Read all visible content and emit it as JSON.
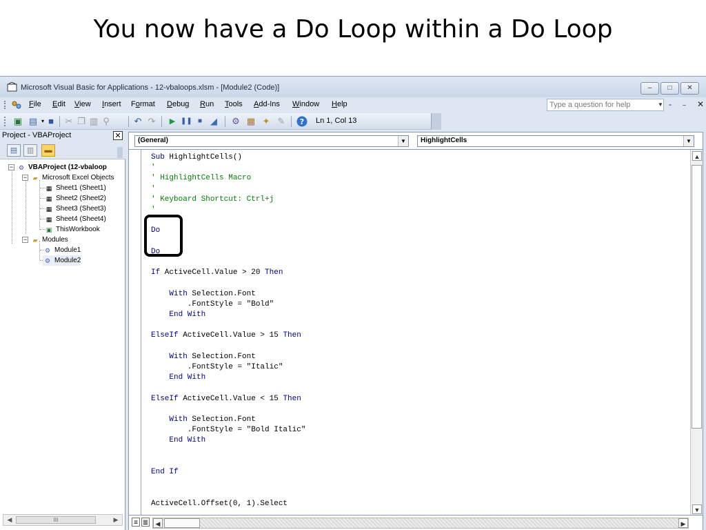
{
  "slide": {
    "title": "You now have a Do Loop within a Do Loop"
  },
  "window": {
    "title": "Microsoft Visual Basic for Applications - 12-vbaloops.xlsm - [Module2 (Code)]",
    "buttons": {
      "minimize": "–",
      "maximize": "□",
      "close": "✕"
    }
  },
  "menubar": {
    "items": [
      {
        "label": "File",
        "key": "F",
        "rest": "ile"
      },
      {
        "label": "Edit",
        "key": "E",
        "rest": "dit"
      },
      {
        "label": "View",
        "key": "V",
        "rest": "iew"
      },
      {
        "label": "Insert",
        "key": "I",
        "rest": "nsert"
      },
      {
        "label": "Format",
        "key": "o",
        "pre": "F",
        "rest": "rmat"
      },
      {
        "label": "Debug",
        "key": "D",
        "rest": "ebug"
      },
      {
        "label": "Run",
        "key": "R",
        "rest": "un"
      },
      {
        "label": "Tools",
        "key": "T",
        "rest": "ools"
      },
      {
        "label": "Add-Ins",
        "key": "A",
        "rest": "dd-Ins"
      },
      {
        "label": "Window",
        "key": "W",
        "rest": "indow"
      },
      {
        "label": "Help",
        "key": "H",
        "rest": "elp"
      }
    ],
    "help_placeholder": "Type a question for help",
    "mdi_buttons": "- ₋ ✕"
  },
  "toolbar": {
    "position": "Ln 1, Col 13",
    "icons": [
      "view-excel-icon",
      "insert-module-icon",
      "save-icon",
      "cut-icon",
      "copy-icon",
      "paste-icon",
      "find-icon",
      "undo-icon",
      "redo-icon",
      "run-icon",
      "break-icon",
      "reset-icon",
      "design-mode-icon",
      "project-explorer-icon",
      "properties-icon",
      "object-browser-icon",
      "toolbox-icon",
      "help-icon"
    ]
  },
  "project": {
    "header": "Project - VBAProject",
    "close": "✕",
    "tree": {
      "root": "VBAProject (12-vbaloop",
      "excel_objects": "Microsoft Excel Objects",
      "sheets": [
        "Sheet1 (Sheet1)",
        "Sheet2 (Sheet2)",
        "Sheet3 (Sheet3)",
        "Sheet4 (Sheet4)",
        "ThisWorkbook"
      ],
      "modules_folder": "Modules",
      "modules": [
        "Module1",
        "Module2"
      ]
    },
    "scroll_thumb": "III"
  },
  "editor": {
    "object_combo": "(General)",
    "procedure_combo": "HighlightCells",
    "code": [
      {
        "text": "Sub HighlightCells()",
        "style": "kw-lead"
      },
      {
        "text": "'",
        "style": "cm"
      },
      {
        "text": "' HighlightCells Macro",
        "style": "cm"
      },
      {
        "text": "'",
        "style": "cm"
      },
      {
        "text": "' Keyboard Shortcut: Ctrl+j",
        "style": "cm"
      },
      {
        "text": "'",
        "style": "cm"
      },
      {
        "text": "",
        "style": "tx"
      },
      {
        "text": "Do",
        "style": "kw"
      },
      {
        "text": "",
        "style": "tx"
      },
      {
        "text": "Do",
        "style": "kw"
      },
      {
        "text": "",
        "style": "tx"
      },
      {
        "text": "If ActiveCell.Value > 20 Then",
        "style": "if"
      },
      {
        "text": "",
        "style": "tx"
      },
      {
        "text": "    With Selection.Font",
        "style": "with"
      },
      {
        "text": "        .FontStyle = \"Bold\"",
        "style": "tx"
      },
      {
        "text": "    End With",
        "style": "kw"
      },
      {
        "text": "",
        "style": "tx"
      },
      {
        "text": "ElseIf ActiveCell.Value > 15 Then",
        "style": "elseif"
      },
      {
        "text": "",
        "style": "tx"
      },
      {
        "text": "    With Selection.Font",
        "style": "with"
      },
      {
        "text": "        .FontStyle = \"Italic\"",
        "style": "tx"
      },
      {
        "text": "    End With",
        "style": "kw"
      },
      {
        "text": "",
        "style": "tx"
      },
      {
        "text": "ElseIf ActiveCell.Value < 15 Then",
        "style": "elseif"
      },
      {
        "text": "",
        "style": "tx"
      },
      {
        "text": "    With Selection.Font",
        "style": "with"
      },
      {
        "text": "        .FontStyle = \"Bold Italic\"",
        "style": "tx"
      },
      {
        "text": "    End With",
        "style": "kw"
      },
      {
        "text": "",
        "style": "tx"
      },
      {
        "text": "",
        "style": "tx"
      },
      {
        "text": "End If",
        "style": "kw"
      },
      {
        "text": "",
        "style": "tx"
      },
      {
        "text": "",
        "style": "tx"
      },
      {
        "text": "ActiveCell.Offset(0, 1).Select",
        "style": "tx"
      }
    ]
  },
  "colors": {
    "keyword": "#00008b",
    "comment": "#008000",
    "highlight_box": "#000000"
  }
}
